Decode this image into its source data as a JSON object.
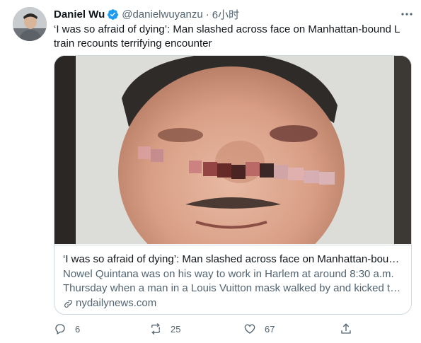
{
  "author": {
    "name": "Daniel Wu",
    "handle": "@danielwuyanzu",
    "time": "6小时",
    "separator": "·"
  },
  "tweet": {
    "text": "‘I was so afraid of dying’: Man slashed across face on Manhattan-bound L train recounts terrifying encounter"
  },
  "card": {
    "title": "‘I was so afraid of dying’: Man slashed across face on Manhattan-bound…",
    "description_line1": "Nowel Quintana was on his way to work in Harlem at around 8:30 a.m.",
    "description_line2": "Thursday when a man in a Louis Vuitton mask walked by and kicked the…",
    "domain": "nydailynews.com"
  },
  "actions": {
    "replies": "6",
    "retweets": "25",
    "likes": "67"
  },
  "icons": {
    "verified": "verified-badge-icon",
    "more": "more-icon",
    "reply": "reply-icon",
    "retweet": "retweet-icon",
    "like": "like-icon",
    "share": "share-icon",
    "link": "link-icon"
  },
  "colors": {
    "verified": "#1d9bf0",
    "secondary_text": "#536471",
    "border": "#cfd9de"
  }
}
